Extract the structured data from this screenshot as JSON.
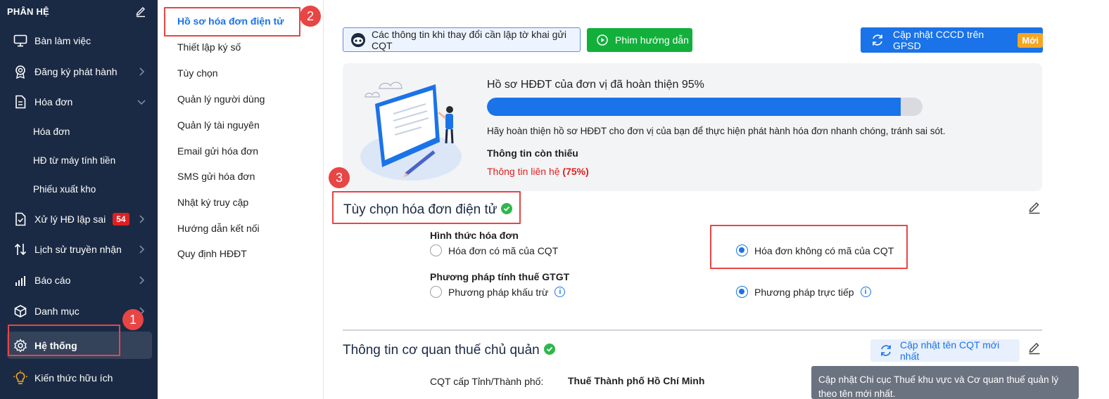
{
  "sidebar": {
    "header": "PHÂN HỆ",
    "items": [
      {
        "label": "Bàn làm việc",
        "icon": "monitor-icon"
      },
      {
        "label": "Đăng ký phát hành",
        "icon": "badge-icon"
      },
      {
        "label": "Hóa đơn",
        "icon": "document-icon"
      },
      {
        "label": "Xử lý HĐ lập sai",
        "icon": "document-check-icon",
        "badge": "54"
      },
      {
        "label": "Lịch sử truyền nhận",
        "icon": "arrows-updown-icon"
      },
      {
        "label": "Báo cáo",
        "icon": "bar-chart-icon"
      },
      {
        "label": "Danh mục",
        "icon": "cube-icon"
      },
      {
        "label": "Hệ thống",
        "icon": "gear-icon"
      },
      {
        "label": "Kiến thức hữu ích",
        "icon": "lightbulb-icon"
      }
    ],
    "subitems": [
      "Hóa đơn",
      "HĐ từ máy tính tiền",
      "Phiếu xuất kho"
    ]
  },
  "menu": {
    "items": [
      "Hồ sơ hóa đơn điện tử",
      "Thiết lập ký số",
      "Tùy chọn",
      "Quản lý người dùng",
      "Quản lý tài nguyên",
      "Email gửi hóa đơn",
      "SMS gửi hóa đơn",
      "Nhật ký truy cập",
      "Hướng dẫn kết nối",
      "Quy định HĐĐT"
    ]
  },
  "annotations": [
    "1",
    "2",
    "3"
  ],
  "toolbar": {
    "info_label": "Các thông tin khi thay đổi cần lập tờ khai gửi CQT",
    "video_label": "Phim hướng dẫn",
    "update_label": "Cập nhật CCCD trên GPSD",
    "new_badge": "Mới"
  },
  "profile_card": {
    "title": "Hồ sơ HĐĐT của đơn vị đã hoàn thiện 95%",
    "progress": 0.95,
    "description": "Hãy hoàn thiện hồ sơ HĐĐT cho đơn vị của bạn để thực hiện phát hành hóa đơn nhanh chóng, tránh sai sót.",
    "missing_title": "Thông tin còn thiếu",
    "missing_item": "Thông tin liên hệ",
    "missing_percent": "(75%)"
  },
  "invoice_options": {
    "title": "Tùy chọn hóa đơn điện tử",
    "form_label": "Hình thức hóa đơn",
    "form_options": [
      "Hóa đơn có mã của CQT",
      "Hóa đơn không có mã của CQT"
    ],
    "form_selected": 1,
    "vat_label": "Phương pháp tính thuế GTGT",
    "vat_options": [
      "Phương pháp khấu trừ",
      "Phương pháp trực tiếp"
    ],
    "vat_selected": 1
  },
  "tax_authority": {
    "title": "Thông tin cơ quan thuế chủ quản",
    "update_button": "Cập nhật tên CQT mới nhất",
    "tooltip": "Cập nhật Chi cục Thuế khu vực và Cơ quan thuế quản lý theo tên mới nhất.",
    "field_label": "CQT cấp Tỉnh/Thành phố:",
    "field_value": "Thuế Thành phố Hồ Chí Minh"
  },
  "colors": {
    "sidebar_bg": "#1b2a44",
    "accent": "#1a73e8",
    "green": "#12b03b",
    "annotation_red": "#e84545"
  }
}
